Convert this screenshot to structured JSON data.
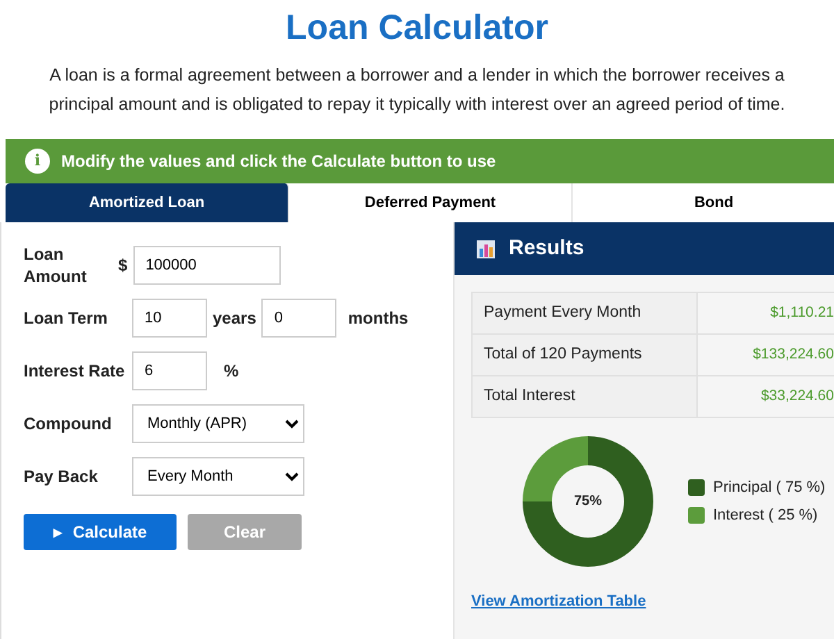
{
  "title": "Loan Calculator",
  "intro": "A loan is a formal agreement between a borrower and a lender in which the borrower receives a principal amount and is obligated to repay it typically with interest over an agreed period of time.",
  "notice": {
    "icon": "i",
    "text": "Modify the values and click the Calculate button to use"
  },
  "tabs": [
    {
      "label": "Amortized Loan",
      "selected": true
    },
    {
      "label": "Deferred Payment",
      "selected": false
    },
    {
      "label": "Bond",
      "selected": false
    }
  ],
  "form": {
    "fields": [
      {
        "kind": "amount",
        "label": "Loan Amount",
        "prefix": "$",
        "value": "100000"
      },
      {
        "kind": "term",
        "label": "Loan Term",
        "value": "10",
        "unit": "years",
        "value_2": "0",
        "unit_2": "months"
      },
      {
        "kind": "rate",
        "label": "Interest Rate",
        "value": "6",
        "unit": "%"
      },
      {
        "kind": "select",
        "label": "Compound",
        "value": "Monthly (APR)"
      },
      {
        "kind": "select",
        "label": "Pay Back",
        "value": "Every Month"
      }
    ],
    "buttons": [
      {
        "kind": "primary",
        "icon": "▸",
        "label": "Calculate"
      },
      {
        "kind": "secondary",
        "label": "Clear"
      }
    ]
  },
  "results": {
    "title": "Results",
    "rows": [
      {
        "label": "Payment Every Month",
        "value": "$1,110.21"
      },
      {
        "label": "Total of 120 Payments",
        "value": "$133,224.60"
      },
      {
        "label": "Total Interest",
        "value": "$33,224.60"
      }
    ],
    "chart_data": {
      "type": "donut",
      "values": [
        75,
        25
      ]
    },
    "center_label": "75%",
    "legend": [
      {
        "label": "Principal ( 75 %)",
        "color": "#2f5f1f"
      },
      {
        "label": "Interest ( 25 %)",
        "color": "#5c9c3c"
      }
    ],
    "link": "View Amortization Table"
  }
}
